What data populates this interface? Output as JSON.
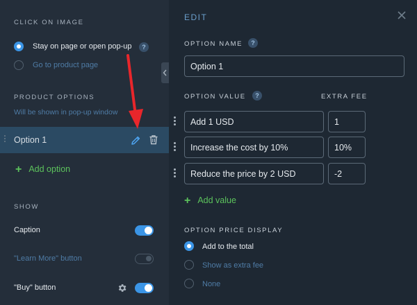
{
  "left": {
    "click_title": "CLICK ON IMAGE",
    "click_options": [
      {
        "label": "Stay on page or open pop-up",
        "selected": true
      },
      {
        "label": "Go to product page",
        "selected": false
      }
    ],
    "product_title": "PRODUCT OPTIONS",
    "product_hint": "Will be shown in pop-up window",
    "option_item": "Option 1",
    "add_option": "Add option",
    "show_title": "SHOW",
    "show_items": [
      {
        "label": "Caption",
        "on": true
      },
      {
        "label": "\"Learn More\" button",
        "on": false
      },
      {
        "label": "\"Buy\" button",
        "on": true
      }
    ],
    "help_mark": "?"
  },
  "right": {
    "edit_title": "EDIT",
    "option_name_title": "OPTION NAME",
    "option_name_value": "Option 1",
    "option_value_title": "OPTION VALUE",
    "extra_fee_title": "EXTRA FEE",
    "values": [
      {
        "value": "Add 1 USD",
        "fee": "1"
      },
      {
        "value": "Increase the cost by 10%",
        "fee": "10%"
      },
      {
        "value": "Reduce the price by 2 USD",
        "fee": "-2"
      }
    ],
    "add_value": "Add value",
    "price_display_title": "OPTION PRICE DISPLAY",
    "price_display_options": [
      {
        "label": "Add to the total",
        "selected": true
      },
      {
        "label": "Show as extra fee",
        "selected": false
      },
      {
        "label": "None",
        "selected": false
      }
    ]
  },
  "colors": {
    "accent": "#3b95e6",
    "green": "#5cc25c",
    "arrow": "#e8262b",
    "highlight_row": "#2b4a63"
  }
}
